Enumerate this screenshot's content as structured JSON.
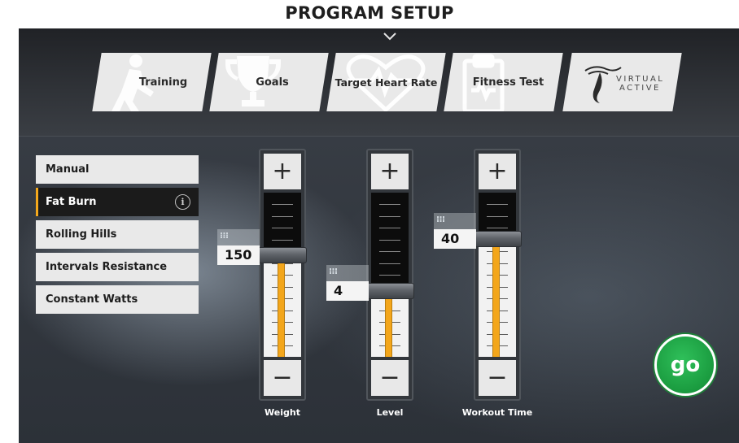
{
  "header": {
    "title": "PROGRAM SETUP"
  },
  "tabs": [
    {
      "label": "Training",
      "icon": "running-person-icon"
    },
    {
      "label": "Goals",
      "icon": "trophy-icon"
    },
    {
      "label": "Target Heart Rate",
      "icon": "heart-rate-icon"
    },
    {
      "label": "Fitness Test",
      "icon": "clipboard-icon"
    },
    {
      "label": "VIRTUAL ACTIVE",
      "label_line1": "VIRTUAL",
      "label_line2": "ACTIVE",
      "icon": "virtual-active-logo"
    }
  ],
  "programs": [
    {
      "label": "Manual",
      "active": false
    },
    {
      "label": "Fat Burn",
      "active": true,
      "info_icon": "i"
    },
    {
      "label": "Rolling Hills",
      "active": false
    },
    {
      "label": "Intervals Resistance",
      "active": false
    },
    {
      "label": "Constant Watts",
      "active": false
    }
  ],
  "sliders": [
    {
      "label": "Weight",
      "value": "150",
      "level_fraction": 0.62,
      "plus": "+",
      "minus": "−"
    },
    {
      "label": "Level",
      "value": "4",
      "level_fraction": 0.4,
      "plus": "+",
      "minus": "−"
    },
    {
      "label": "Workout Time",
      "value": "40",
      "level_fraction": 0.72,
      "plus": "+",
      "minus": "−"
    }
  ],
  "go_button": {
    "label": "go"
  },
  "colors": {
    "accent": "#f3a61b",
    "go_green": "#1a9b3f",
    "active_item_bg": "#1b1b1b",
    "tab_bg": "#e9e9e9"
  }
}
